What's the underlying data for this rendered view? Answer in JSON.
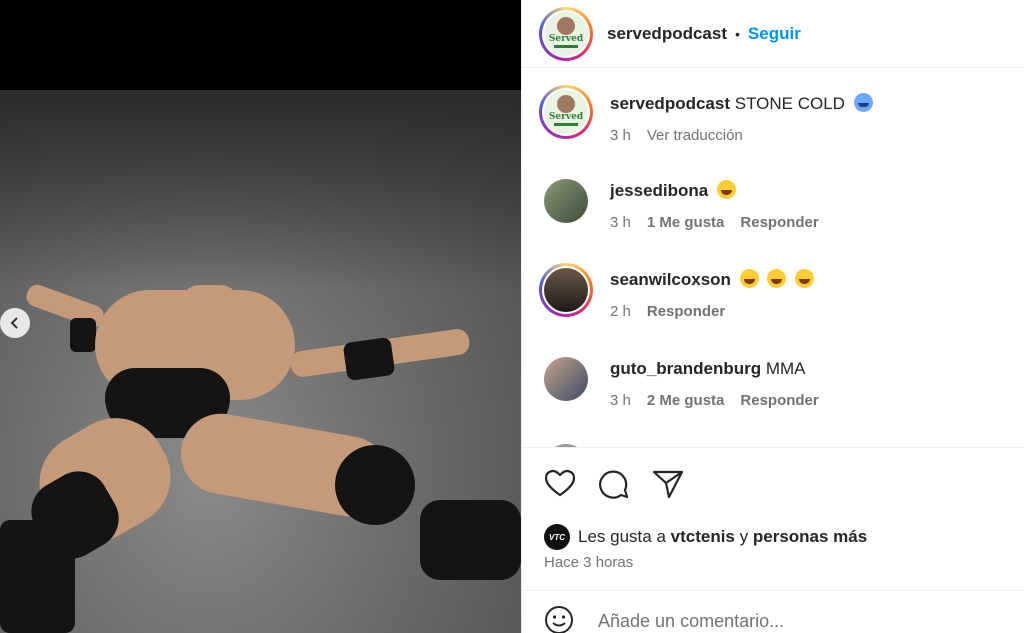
{
  "post": {
    "author": "servedpodcast",
    "follow_label": "Seguir",
    "separator": "•",
    "avatar_logo": "Served"
  },
  "caption": {
    "username": "servedpodcast",
    "text": "STONE COLD",
    "emoji": "cold-face-emoji",
    "time": "3 h",
    "translate_label": "Ver traducción"
  },
  "comments": [
    {
      "username": "jessedibona",
      "text": "",
      "emojis": [
        "laughing-tears-emoji"
      ],
      "time": "3 h",
      "likes": "1 Me gusta",
      "reply": "Responder"
    },
    {
      "username": "seanwilcoxson",
      "text": "",
      "emojis": [
        "laughing-tears-emoji",
        "laughing-tears-emoji",
        "laughing-tears-emoji"
      ],
      "time": "2 h",
      "likes": "",
      "reply": "Responder"
    },
    {
      "username": "guto_brandenburg",
      "text": "MMA",
      "emojis": [],
      "time": "3 h",
      "likes": "2 Me gusta",
      "reply": "Responder"
    }
  ],
  "actions": {
    "liked_by_prefix": "Les gusta a",
    "liked_by_user": "vtctenis",
    "liked_by_joiner": "y",
    "liked_by_others": "personas más",
    "liker_avatar_text": "VTC",
    "posted_time": "Hace 3 horas"
  },
  "composer": {
    "placeholder": "Añade un comentario..."
  },
  "colors": {
    "link": "#0095f6",
    "muted": "#737373",
    "text": "#262626"
  }
}
